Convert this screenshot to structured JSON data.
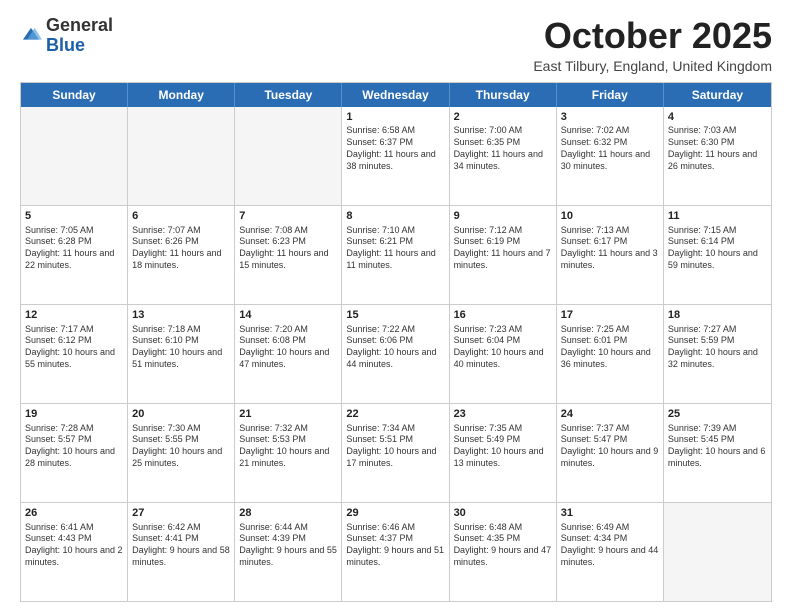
{
  "header": {
    "logo": {
      "general": "General",
      "blue": "Blue"
    },
    "title": "October 2025",
    "location": "East Tilbury, England, United Kingdom"
  },
  "calendar": {
    "days": [
      "Sunday",
      "Monday",
      "Tuesday",
      "Wednesday",
      "Thursday",
      "Friday",
      "Saturday"
    ],
    "rows": [
      [
        {
          "day": "",
          "empty": true
        },
        {
          "day": "",
          "empty": true
        },
        {
          "day": "",
          "empty": true
        },
        {
          "day": "1",
          "sunrise": "Sunrise: 6:58 AM",
          "sunset": "Sunset: 6:37 PM",
          "daylight": "Daylight: 11 hours and 38 minutes."
        },
        {
          "day": "2",
          "sunrise": "Sunrise: 7:00 AM",
          "sunset": "Sunset: 6:35 PM",
          "daylight": "Daylight: 11 hours and 34 minutes."
        },
        {
          "day": "3",
          "sunrise": "Sunrise: 7:02 AM",
          "sunset": "Sunset: 6:32 PM",
          "daylight": "Daylight: 11 hours and 30 minutes."
        },
        {
          "day": "4",
          "sunrise": "Sunrise: 7:03 AM",
          "sunset": "Sunset: 6:30 PM",
          "daylight": "Daylight: 11 hours and 26 minutes."
        }
      ],
      [
        {
          "day": "5",
          "sunrise": "Sunrise: 7:05 AM",
          "sunset": "Sunset: 6:28 PM",
          "daylight": "Daylight: 11 hours and 22 minutes."
        },
        {
          "day": "6",
          "sunrise": "Sunrise: 7:07 AM",
          "sunset": "Sunset: 6:26 PM",
          "daylight": "Daylight: 11 hours and 18 minutes."
        },
        {
          "day": "7",
          "sunrise": "Sunrise: 7:08 AM",
          "sunset": "Sunset: 6:23 PM",
          "daylight": "Daylight: 11 hours and 15 minutes."
        },
        {
          "day": "8",
          "sunrise": "Sunrise: 7:10 AM",
          "sunset": "Sunset: 6:21 PM",
          "daylight": "Daylight: 11 hours and 11 minutes."
        },
        {
          "day": "9",
          "sunrise": "Sunrise: 7:12 AM",
          "sunset": "Sunset: 6:19 PM",
          "daylight": "Daylight: 11 hours and 7 minutes."
        },
        {
          "day": "10",
          "sunrise": "Sunrise: 7:13 AM",
          "sunset": "Sunset: 6:17 PM",
          "daylight": "Daylight: 11 hours and 3 minutes."
        },
        {
          "day": "11",
          "sunrise": "Sunrise: 7:15 AM",
          "sunset": "Sunset: 6:14 PM",
          "daylight": "Daylight: 10 hours and 59 minutes."
        }
      ],
      [
        {
          "day": "12",
          "sunrise": "Sunrise: 7:17 AM",
          "sunset": "Sunset: 6:12 PM",
          "daylight": "Daylight: 10 hours and 55 minutes."
        },
        {
          "day": "13",
          "sunrise": "Sunrise: 7:18 AM",
          "sunset": "Sunset: 6:10 PM",
          "daylight": "Daylight: 10 hours and 51 minutes."
        },
        {
          "day": "14",
          "sunrise": "Sunrise: 7:20 AM",
          "sunset": "Sunset: 6:08 PM",
          "daylight": "Daylight: 10 hours and 47 minutes."
        },
        {
          "day": "15",
          "sunrise": "Sunrise: 7:22 AM",
          "sunset": "Sunset: 6:06 PM",
          "daylight": "Daylight: 10 hours and 44 minutes."
        },
        {
          "day": "16",
          "sunrise": "Sunrise: 7:23 AM",
          "sunset": "Sunset: 6:04 PM",
          "daylight": "Daylight: 10 hours and 40 minutes."
        },
        {
          "day": "17",
          "sunrise": "Sunrise: 7:25 AM",
          "sunset": "Sunset: 6:01 PM",
          "daylight": "Daylight: 10 hours and 36 minutes."
        },
        {
          "day": "18",
          "sunrise": "Sunrise: 7:27 AM",
          "sunset": "Sunset: 5:59 PM",
          "daylight": "Daylight: 10 hours and 32 minutes."
        }
      ],
      [
        {
          "day": "19",
          "sunrise": "Sunrise: 7:28 AM",
          "sunset": "Sunset: 5:57 PM",
          "daylight": "Daylight: 10 hours and 28 minutes."
        },
        {
          "day": "20",
          "sunrise": "Sunrise: 7:30 AM",
          "sunset": "Sunset: 5:55 PM",
          "daylight": "Daylight: 10 hours and 25 minutes."
        },
        {
          "day": "21",
          "sunrise": "Sunrise: 7:32 AM",
          "sunset": "Sunset: 5:53 PM",
          "daylight": "Daylight: 10 hours and 21 minutes."
        },
        {
          "day": "22",
          "sunrise": "Sunrise: 7:34 AM",
          "sunset": "Sunset: 5:51 PM",
          "daylight": "Daylight: 10 hours and 17 minutes."
        },
        {
          "day": "23",
          "sunrise": "Sunrise: 7:35 AM",
          "sunset": "Sunset: 5:49 PM",
          "daylight": "Daylight: 10 hours and 13 minutes."
        },
        {
          "day": "24",
          "sunrise": "Sunrise: 7:37 AM",
          "sunset": "Sunset: 5:47 PM",
          "daylight": "Daylight: 10 hours and 9 minutes."
        },
        {
          "day": "25",
          "sunrise": "Sunrise: 7:39 AM",
          "sunset": "Sunset: 5:45 PM",
          "daylight": "Daylight: 10 hours and 6 minutes."
        }
      ],
      [
        {
          "day": "26",
          "sunrise": "Sunrise: 6:41 AM",
          "sunset": "Sunset: 4:43 PM",
          "daylight": "Daylight: 10 hours and 2 minutes."
        },
        {
          "day": "27",
          "sunrise": "Sunrise: 6:42 AM",
          "sunset": "Sunset: 4:41 PM",
          "daylight": "Daylight: 9 hours and 58 minutes."
        },
        {
          "day": "28",
          "sunrise": "Sunrise: 6:44 AM",
          "sunset": "Sunset: 4:39 PM",
          "daylight": "Daylight: 9 hours and 55 minutes."
        },
        {
          "day": "29",
          "sunrise": "Sunrise: 6:46 AM",
          "sunset": "Sunset: 4:37 PM",
          "daylight": "Daylight: 9 hours and 51 minutes."
        },
        {
          "day": "30",
          "sunrise": "Sunrise: 6:48 AM",
          "sunset": "Sunset: 4:35 PM",
          "daylight": "Daylight: 9 hours and 47 minutes."
        },
        {
          "day": "31",
          "sunrise": "Sunrise: 6:49 AM",
          "sunset": "Sunset: 4:34 PM",
          "daylight": "Daylight: 9 hours and 44 minutes."
        },
        {
          "day": "",
          "empty": true
        }
      ]
    ]
  }
}
